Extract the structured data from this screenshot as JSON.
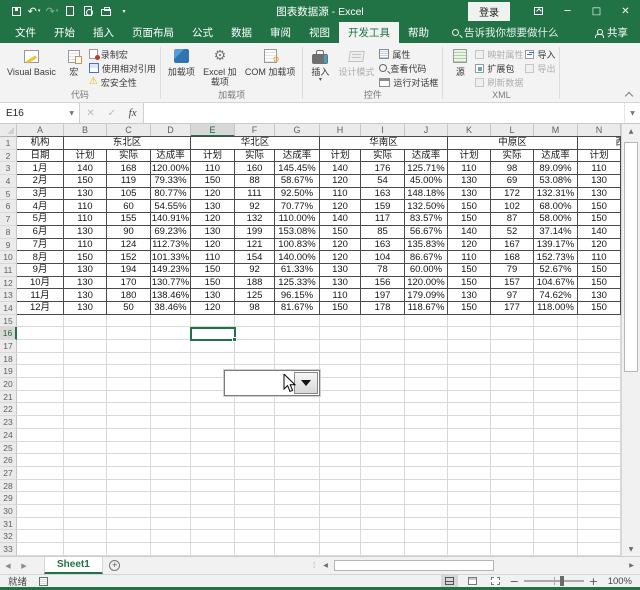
{
  "titlebar": {
    "title": "图表数据源 - Excel",
    "signin_label": "登录",
    "qat_icons": [
      "save-icon",
      "undo-icon",
      "redo-icon",
      "new-file-icon",
      "print-preview-icon",
      "print-icon",
      "customize-qat-icon"
    ]
  },
  "tab_row": {
    "tabs": [
      {
        "key": "file",
        "label": "文件"
      },
      {
        "key": "home",
        "label": "开始"
      },
      {
        "key": "insert",
        "label": "插入"
      },
      {
        "key": "page-layout",
        "label": "页面布局"
      },
      {
        "key": "formulas",
        "label": "公式"
      },
      {
        "key": "data",
        "label": "数据"
      },
      {
        "key": "review",
        "label": "审阅"
      },
      {
        "key": "view",
        "label": "视图"
      },
      {
        "key": "developer",
        "label": "开发工具"
      },
      {
        "key": "help",
        "label": "帮助"
      }
    ],
    "active": "developer",
    "search_label": "告诉我你想要做什么",
    "share_label": "共享"
  },
  "ribbon": {
    "code_group": {
      "label": "代码",
      "visual_basic": "Visual Basic",
      "macros": "宏",
      "record_macro": "录制宏",
      "relative_references": "使用相对引用",
      "macro_security": "宏安全性"
    },
    "addins_group": {
      "label": "加载项",
      "addins": "加载项",
      "excel_addins": "Excel 加载项",
      "com_addins": "COM 加载项"
    },
    "controls_group": {
      "label": "控件",
      "insert": "插入",
      "design_mode": "设计模式",
      "properties": "属性",
      "view_code": "查看代码",
      "run_dialog": "运行对话框"
    },
    "xml_group": {
      "label": "XML",
      "source": "源",
      "map_properties": "映射属性",
      "expansion_packs": "扩展包",
      "refresh_data": "刷新数据",
      "import": "导入",
      "export": "导出"
    }
  },
  "formula_bar": {
    "name_box": "E16",
    "fx_label": "fx",
    "value": ""
  },
  "sheet": {
    "columns": [
      "A",
      "B",
      "C",
      "D",
      "E",
      "F",
      "G",
      "H",
      "I",
      "J",
      "K",
      "L",
      "M",
      "N"
    ],
    "selected_cell": "E16",
    "selected_column": "E",
    "selected_row": 16,
    "visible_rows": 33,
    "region_row": {
      "org": "机构",
      "regions": [
        {
          "label": "东北区",
          "cols": 3
        },
        {
          "label": "华北区",
          "cols": 3
        },
        {
          "label": "华南区",
          "cols": 3
        },
        {
          "label": "中原区",
          "cols": 3
        },
        {
          "label": "西",
          "cols": 1,
          "clipped": true
        }
      ]
    },
    "subheader_row": [
      "日期",
      "计划",
      "实际",
      "达成率",
      "计划",
      "实际",
      "达成率",
      "计划",
      "实际",
      "达成率",
      "计划",
      "实际",
      "达成率",
      "计划"
    ],
    "data_rows": [
      [
        "1月",
        "140",
        "168",
        "120.00%",
        "110",
        "160",
        "145.45%",
        "140",
        "176",
        "125.71%",
        "110",
        "98",
        "89.09%",
        "110"
      ],
      [
        "2月",
        "150",
        "119",
        "79.33%",
        "150",
        "88",
        "58.67%",
        "120",
        "54",
        "45.00%",
        "130",
        "69",
        "53.08%",
        "130"
      ],
      [
        "3月",
        "130",
        "105",
        "80.77%",
        "120",
        "111",
        "92.50%",
        "110",
        "163",
        "148.18%",
        "130",
        "172",
        "132.31%",
        "130"
      ],
      [
        "4月",
        "110",
        "60",
        "54.55%",
        "130",
        "92",
        "70.77%",
        "120",
        "159",
        "132.50%",
        "150",
        "102",
        "68.00%",
        "150"
      ],
      [
        "5月",
        "110",
        "155",
        "140.91%",
        "120",
        "132",
        "110.00%",
        "140",
        "117",
        "83.57%",
        "150",
        "87",
        "58.00%",
        "150"
      ],
      [
        "6月",
        "130",
        "90",
        "69.23%",
        "130",
        "199",
        "153.08%",
        "150",
        "85",
        "56.67%",
        "140",
        "52",
        "37.14%",
        "140"
      ],
      [
        "7月",
        "110",
        "124",
        "112.73%",
        "120",
        "121",
        "100.83%",
        "120",
        "163",
        "135.83%",
        "120",
        "167",
        "139.17%",
        "120"
      ],
      [
        "8月",
        "150",
        "152",
        "101.33%",
        "110",
        "154",
        "140.00%",
        "120",
        "104",
        "86.67%",
        "110",
        "168",
        "152.73%",
        "110"
      ],
      [
        "9月",
        "130",
        "194",
        "149.23%",
        "150",
        "92",
        "61.33%",
        "130",
        "78",
        "60.00%",
        "150",
        "79",
        "52.67%",
        "150"
      ],
      [
        "10月",
        "130",
        "170",
        "130.77%",
        "150",
        "188",
        "125.33%",
        "130",
        "156",
        "120.00%",
        "150",
        "157",
        "104.67%",
        "150"
      ],
      [
        "11月",
        "130",
        "180",
        "138.46%",
        "130",
        "125",
        "96.15%",
        "110",
        "197",
        "179.09%",
        "130",
        "97",
        "74.62%",
        "130"
      ],
      [
        "12月",
        "130",
        "50",
        "38.46%",
        "120",
        "98",
        "81.67%",
        "150",
        "178",
        "118.67%",
        "150",
        "177",
        "118.00%",
        "150"
      ]
    ]
  },
  "overlays": {
    "combo_box": {
      "value": ""
    }
  },
  "sheet_tab_bar": {
    "active_tab": "Sheet1"
  },
  "status_bar": {
    "mode": "就绪",
    "zoom_level": "100%"
  }
}
